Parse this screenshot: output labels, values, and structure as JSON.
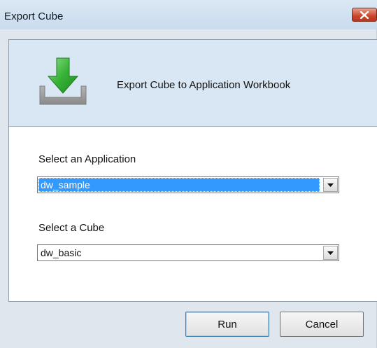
{
  "window": {
    "title": "Export Cube"
  },
  "header": {
    "icon": "export-download-icon",
    "text": "Export Cube to Application Workbook"
  },
  "form": {
    "application": {
      "label": "Select an Application",
      "value": "dw_sample",
      "selected": true
    },
    "cube": {
      "label": "Select a Cube",
      "value": "dw_basic"
    }
  },
  "buttons": {
    "run": "Run",
    "cancel": "Cancel"
  },
  "colors": {
    "selection": "#3399ff",
    "header_band": "#d9e7f5",
    "icon_green": "#2fa52f",
    "close_button": "#c9462b"
  }
}
